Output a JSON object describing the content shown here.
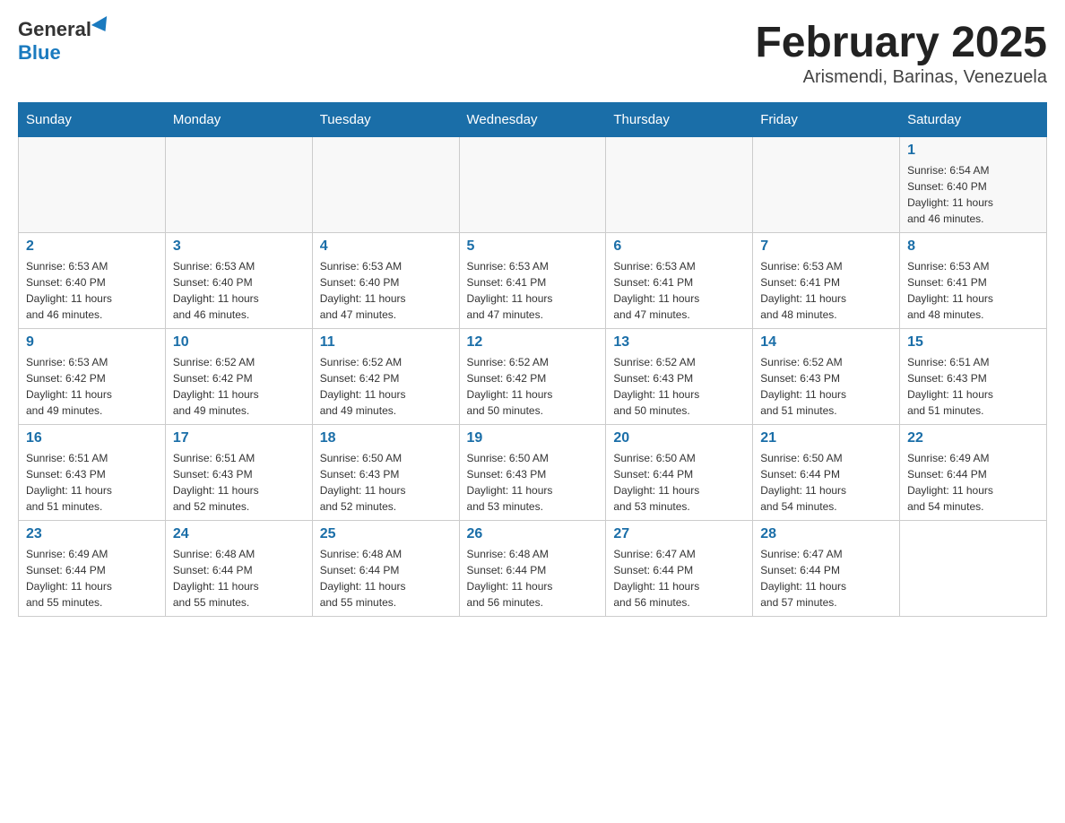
{
  "header": {
    "logo": {
      "general": "General",
      "blue": "Blue"
    },
    "title": "February 2025",
    "subtitle": "Arismendi, Barinas, Venezuela"
  },
  "days_header": [
    "Sunday",
    "Monday",
    "Tuesday",
    "Wednesday",
    "Thursday",
    "Friday",
    "Saturday"
  ],
  "weeks": [
    [
      {
        "day": "",
        "info": ""
      },
      {
        "day": "",
        "info": ""
      },
      {
        "day": "",
        "info": ""
      },
      {
        "day": "",
        "info": ""
      },
      {
        "day": "",
        "info": ""
      },
      {
        "day": "",
        "info": ""
      },
      {
        "day": "1",
        "info": "Sunrise: 6:54 AM\nSunset: 6:40 PM\nDaylight: 11 hours\nand 46 minutes."
      }
    ],
    [
      {
        "day": "2",
        "info": "Sunrise: 6:53 AM\nSunset: 6:40 PM\nDaylight: 11 hours\nand 46 minutes."
      },
      {
        "day": "3",
        "info": "Sunrise: 6:53 AM\nSunset: 6:40 PM\nDaylight: 11 hours\nand 46 minutes."
      },
      {
        "day": "4",
        "info": "Sunrise: 6:53 AM\nSunset: 6:40 PM\nDaylight: 11 hours\nand 47 minutes."
      },
      {
        "day": "5",
        "info": "Sunrise: 6:53 AM\nSunset: 6:41 PM\nDaylight: 11 hours\nand 47 minutes."
      },
      {
        "day": "6",
        "info": "Sunrise: 6:53 AM\nSunset: 6:41 PM\nDaylight: 11 hours\nand 47 minutes."
      },
      {
        "day": "7",
        "info": "Sunrise: 6:53 AM\nSunset: 6:41 PM\nDaylight: 11 hours\nand 48 minutes."
      },
      {
        "day": "8",
        "info": "Sunrise: 6:53 AM\nSunset: 6:41 PM\nDaylight: 11 hours\nand 48 minutes."
      }
    ],
    [
      {
        "day": "9",
        "info": "Sunrise: 6:53 AM\nSunset: 6:42 PM\nDaylight: 11 hours\nand 49 minutes."
      },
      {
        "day": "10",
        "info": "Sunrise: 6:52 AM\nSunset: 6:42 PM\nDaylight: 11 hours\nand 49 minutes."
      },
      {
        "day": "11",
        "info": "Sunrise: 6:52 AM\nSunset: 6:42 PM\nDaylight: 11 hours\nand 49 minutes."
      },
      {
        "day": "12",
        "info": "Sunrise: 6:52 AM\nSunset: 6:42 PM\nDaylight: 11 hours\nand 50 minutes."
      },
      {
        "day": "13",
        "info": "Sunrise: 6:52 AM\nSunset: 6:43 PM\nDaylight: 11 hours\nand 50 minutes."
      },
      {
        "day": "14",
        "info": "Sunrise: 6:52 AM\nSunset: 6:43 PM\nDaylight: 11 hours\nand 51 minutes."
      },
      {
        "day": "15",
        "info": "Sunrise: 6:51 AM\nSunset: 6:43 PM\nDaylight: 11 hours\nand 51 minutes."
      }
    ],
    [
      {
        "day": "16",
        "info": "Sunrise: 6:51 AM\nSunset: 6:43 PM\nDaylight: 11 hours\nand 51 minutes."
      },
      {
        "day": "17",
        "info": "Sunrise: 6:51 AM\nSunset: 6:43 PM\nDaylight: 11 hours\nand 52 minutes."
      },
      {
        "day": "18",
        "info": "Sunrise: 6:50 AM\nSunset: 6:43 PM\nDaylight: 11 hours\nand 52 minutes."
      },
      {
        "day": "19",
        "info": "Sunrise: 6:50 AM\nSunset: 6:43 PM\nDaylight: 11 hours\nand 53 minutes."
      },
      {
        "day": "20",
        "info": "Sunrise: 6:50 AM\nSunset: 6:44 PM\nDaylight: 11 hours\nand 53 minutes."
      },
      {
        "day": "21",
        "info": "Sunrise: 6:50 AM\nSunset: 6:44 PM\nDaylight: 11 hours\nand 54 minutes."
      },
      {
        "day": "22",
        "info": "Sunrise: 6:49 AM\nSunset: 6:44 PM\nDaylight: 11 hours\nand 54 minutes."
      }
    ],
    [
      {
        "day": "23",
        "info": "Sunrise: 6:49 AM\nSunset: 6:44 PM\nDaylight: 11 hours\nand 55 minutes."
      },
      {
        "day": "24",
        "info": "Sunrise: 6:48 AM\nSunset: 6:44 PM\nDaylight: 11 hours\nand 55 minutes."
      },
      {
        "day": "25",
        "info": "Sunrise: 6:48 AM\nSunset: 6:44 PM\nDaylight: 11 hours\nand 55 minutes."
      },
      {
        "day": "26",
        "info": "Sunrise: 6:48 AM\nSunset: 6:44 PM\nDaylight: 11 hours\nand 56 minutes."
      },
      {
        "day": "27",
        "info": "Sunrise: 6:47 AM\nSunset: 6:44 PM\nDaylight: 11 hours\nand 56 minutes."
      },
      {
        "day": "28",
        "info": "Sunrise: 6:47 AM\nSunset: 6:44 PM\nDaylight: 11 hours\nand 57 minutes."
      },
      {
        "day": "",
        "info": ""
      }
    ]
  ]
}
